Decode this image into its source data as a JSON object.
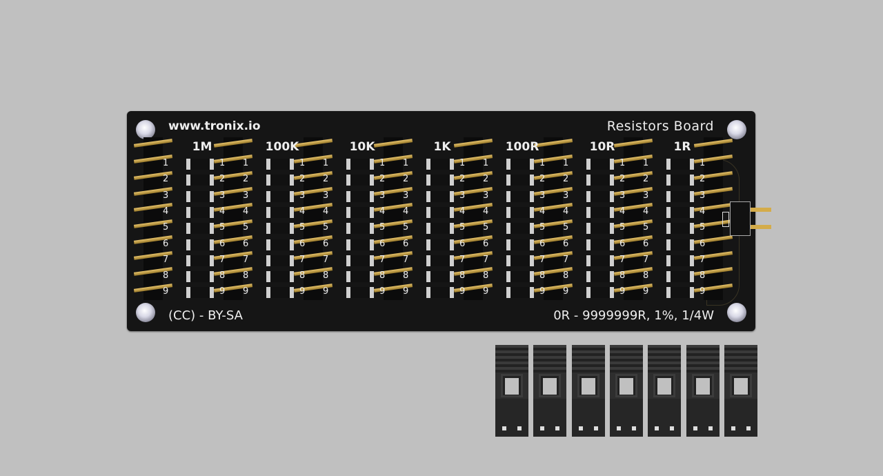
{
  "board": {
    "url": "www.tronix.io",
    "title": "Resistors Board",
    "license": "(CC) - BY-SA",
    "spec": "0R - 9999999R, 1%, 1/4W"
  },
  "columns": [
    "1M",
    "100K",
    "10K",
    "1K",
    "100R",
    "10R",
    "1R"
  ],
  "row_numbers": [
    "1",
    "2",
    "3",
    "4",
    "5",
    "6",
    "7",
    "8",
    "9"
  ],
  "jumpers_count": 7
}
